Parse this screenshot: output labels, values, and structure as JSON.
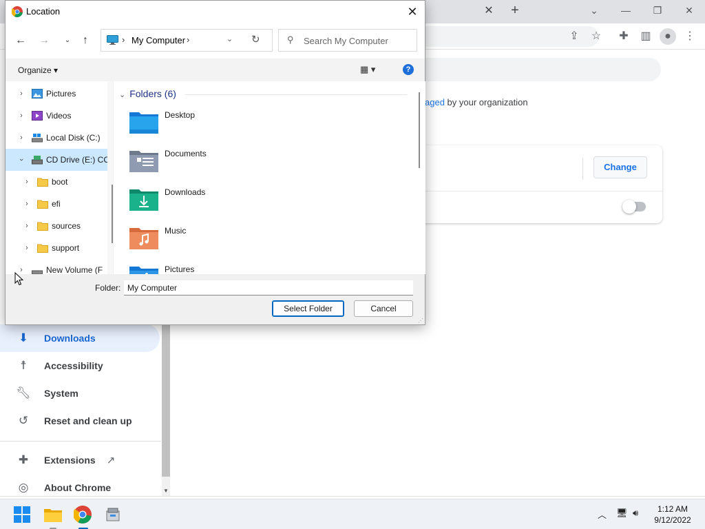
{
  "dialog": {
    "title": "Location",
    "address": "My Computer",
    "search_placeholder": "Search My Computer",
    "organize_label": "Organize ▾",
    "tree": [
      {
        "label": "Pictures"
      },
      {
        "label": "Videos"
      },
      {
        "label": "Local Disk (C:)"
      },
      {
        "label": "CD Drive (E:) CC"
      },
      {
        "label": "boot"
      },
      {
        "label": "efi"
      },
      {
        "label": "sources"
      },
      {
        "label": "support"
      },
      {
        "label": "New Volume (F"
      }
    ],
    "group_header": "Folders (6)",
    "folders": [
      {
        "name": "Desktop"
      },
      {
        "name": "Documents"
      },
      {
        "name": "Downloads"
      },
      {
        "name": "Music"
      },
      {
        "name": "Pictures"
      }
    ],
    "folder_field_label": "Folder:",
    "folder_field_value": "My Computer",
    "select_button": "Select Folder",
    "cancel_button": "Cancel"
  },
  "chrome": {
    "managed_link": "aged",
    "managed_rest": " by your organization",
    "change_button": "Change",
    "sidebar": [
      {
        "label": "Downloads",
        "icon": "download-icon"
      },
      {
        "label": "Accessibility",
        "icon": "accessibility-icon"
      },
      {
        "label": "System",
        "icon": "wrench-icon"
      },
      {
        "label": "Reset and clean up",
        "icon": "history-icon"
      },
      {
        "label": "Extensions",
        "icon": "puzzle-icon"
      },
      {
        "label": "About Chrome",
        "icon": "chrome-icon"
      }
    ]
  },
  "taskbar": {
    "time": "1:12 AM",
    "date": "9/12/2022"
  }
}
